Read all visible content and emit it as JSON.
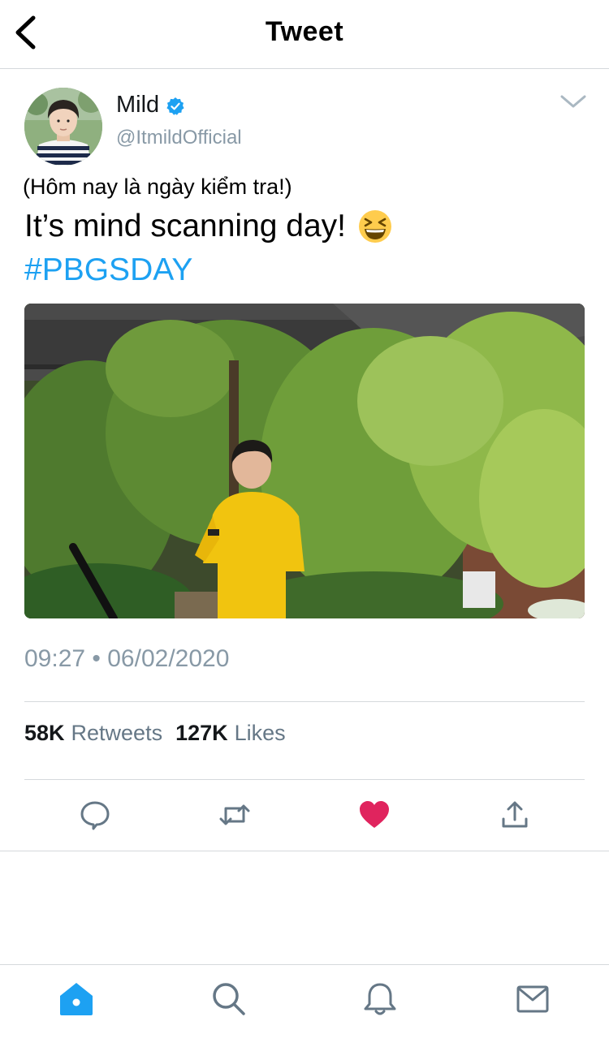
{
  "header": {
    "title": "Tweet"
  },
  "tweet": {
    "author": {
      "display_name": "Mild",
      "handle": "@ItmildOfficial",
      "verified": true
    },
    "text_line1": "(Hôm nay là ngày kiểm tra!)",
    "text_line2": "It’s mind scanning day!",
    "emoji": "grinning-squinting-face",
    "hashtag": "#PBGSDAY",
    "timestamp": "09:27 • 06/02/2020",
    "stats": {
      "retweets_count": "58K",
      "retweets_label": "Retweets",
      "likes_count": "127K",
      "likes_label": "Likes"
    },
    "liked": true
  },
  "actions": [
    "reply-icon",
    "retweet-icon",
    "like-icon",
    "share-icon"
  ],
  "tabs": [
    "home-icon",
    "search-icon",
    "notifications-icon",
    "messages-icon"
  ],
  "colors": {
    "accent": "#1da1f2",
    "like": "#e0245e",
    "secondary_text": "#8899a6",
    "divider": "#d5d9dc"
  }
}
